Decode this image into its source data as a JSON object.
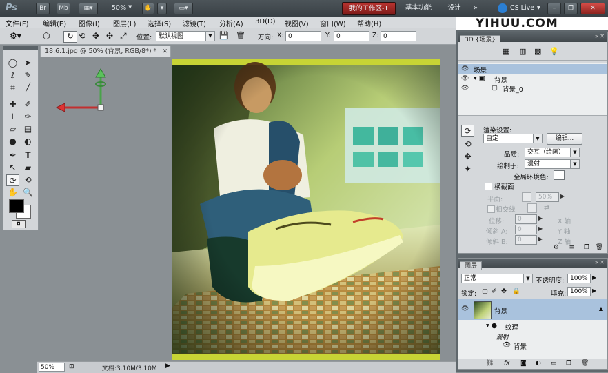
{
  "app": {
    "logo": "Ps",
    "zoom": "50%",
    "workspaces": {
      "active": "我的工作区-1",
      "items": [
        "基本功能",
        "设计",
        "»"
      ]
    },
    "cs_live": "CS Live",
    "watermark": "YIHUU.COM"
  },
  "menu": [
    "文件(F)",
    "编辑(E)",
    "图像(I)",
    "图层(L)",
    "选择(S)",
    "滤镜(T)",
    "分析(A)",
    "3D(D)",
    "视图(V)",
    "窗口(W)",
    "帮助(H)"
  ],
  "options": {
    "position_label": "位置:",
    "position_value": "默认视图",
    "orientation_label": "方向:",
    "x_label": "X:",
    "y_label": "Y:",
    "z_label": "Z:",
    "x_value": "0",
    "y_value": "0",
    "z_value": "0"
  },
  "document": {
    "tab_title": "18.6.1.jpg @ 50% (背景, RGB/8*) *",
    "zoom": "50%",
    "doc_size": "文档:3.10M/3.10M"
  },
  "panel3d": {
    "tab": "3D {场景}",
    "scene_items": [
      "场景",
      "背景",
      "背景_0"
    ],
    "render_settings_label": "渲染设置:",
    "render_preset": "自定",
    "edit_button": "编辑...",
    "quality_label": "品质:",
    "quality_value": "交互（绘画）",
    "paint_on_label": "绘制于:",
    "paint_on_value": "漫射",
    "global_ambient_label": "全局环境色:",
    "cross_section_label": "横截面",
    "plane_label": "平面:",
    "plane_opacity": "50%",
    "intersection_label": "相交线",
    "offset_label": "位移:",
    "tilt_a_label": "倾斜 A:",
    "tilt_b_label": "倾斜 B:",
    "axis_x": "X 轴",
    "axis_y": "Y 轴",
    "axis_z": "Z 轴",
    "zero": "0"
  },
  "layers": {
    "tab": "图层",
    "blend_mode": "正常",
    "opacity_label": "不透明度:",
    "opacity_value": "100%",
    "lock_label": "锁定:",
    "fill_label": "填充:",
    "fill_value": "100%",
    "layer_name": "背景",
    "texture_label": "纹理",
    "diffuse_label": "漫射",
    "sub_layer_name": "背景"
  },
  "colors": {
    "accent_red": "#b8332f",
    "panel_bg": "#d5d8db",
    "canvas_bg": "#8a9094",
    "selection_blue": "#a9c2dd"
  }
}
